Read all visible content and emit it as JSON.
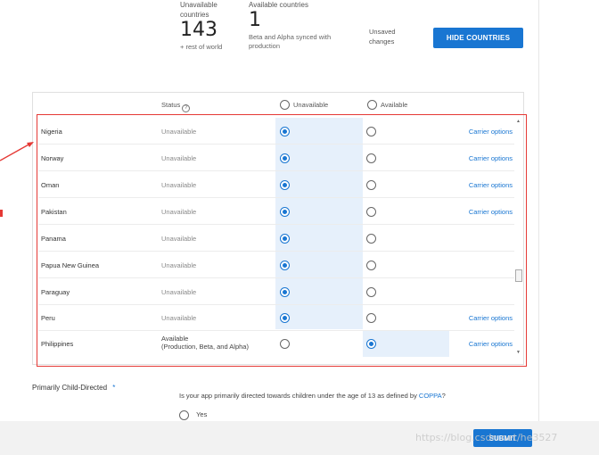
{
  "summary": {
    "unavailable_label": "Unavailable countries",
    "unavailable_count": "143",
    "unavailable_note": "+ rest of world",
    "available_label": "Available countries",
    "available_count": "1",
    "available_note": "Beta and Alpha synced with production",
    "unsaved_label": "Unsaved changes",
    "hide_button": "HIDE COUNTRIES"
  },
  "table": {
    "header_status": "Status",
    "header_unavailable": "Unavailable",
    "header_available": "Available",
    "rows": [
      {
        "country": "Nigeria",
        "status": "Unavailable",
        "selected": "unavailable",
        "carrier": "Carrier options"
      },
      {
        "country": "Norway",
        "status": "Unavailable",
        "selected": "unavailable",
        "carrier": "Carrier options"
      },
      {
        "country": "Oman",
        "status": "Unavailable",
        "selected": "unavailable",
        "carrier": "Carrier options"
      },
      {
        "country": "Pakistan",
        "status": "Unavailable",
        "selected": "unavailable",
        "carrier": "Carrier options"
      },
      {
        "country": "Panama",
        "status": "Unavailable",
        "selected": "unavailable",
        "carrier": ""
      },
      {
        "country": "Papua New Guinea",
        "status": "Unavailable",
        "selected": "unavailable",
        "carrier": ""
      },
      {
        "country": "Paraguay",
        "status": "Unavailable",
        "selected": "unavailable",
        "carrier": ""
      },
      {
        "country": "Peru",
        "status": "Unavailable",
        "selected": "unavailable",
        "carrier": "Carrier options"
      },
      {
        "country": "Philippines",
        "status": "Available",
        "status_detail": "(Production, Beta, and Alpha)",
        "selected": "available",
        "carrier": "Carrier options"
      }
    ]
  },
  "child_directed": {
    "label": "Primarily Child-Directed",
    "required_mark": "*",
    "question": "Is your app primarily directed towards children under the age of 13 as defined by",
    "link": "COPPA",
    "question_end": "?",
    "yes_option": "Yes"
  },
  "footer": {
    "submit_button": "SUBMIT",
    "watermark": "https://blog.csdn.net/he3527"
  },
  "colors": {
    "accent": "#1976d2",
    "highlight": "#e6f0fb",
    "annotation_red": "#e53935"
  }
}
